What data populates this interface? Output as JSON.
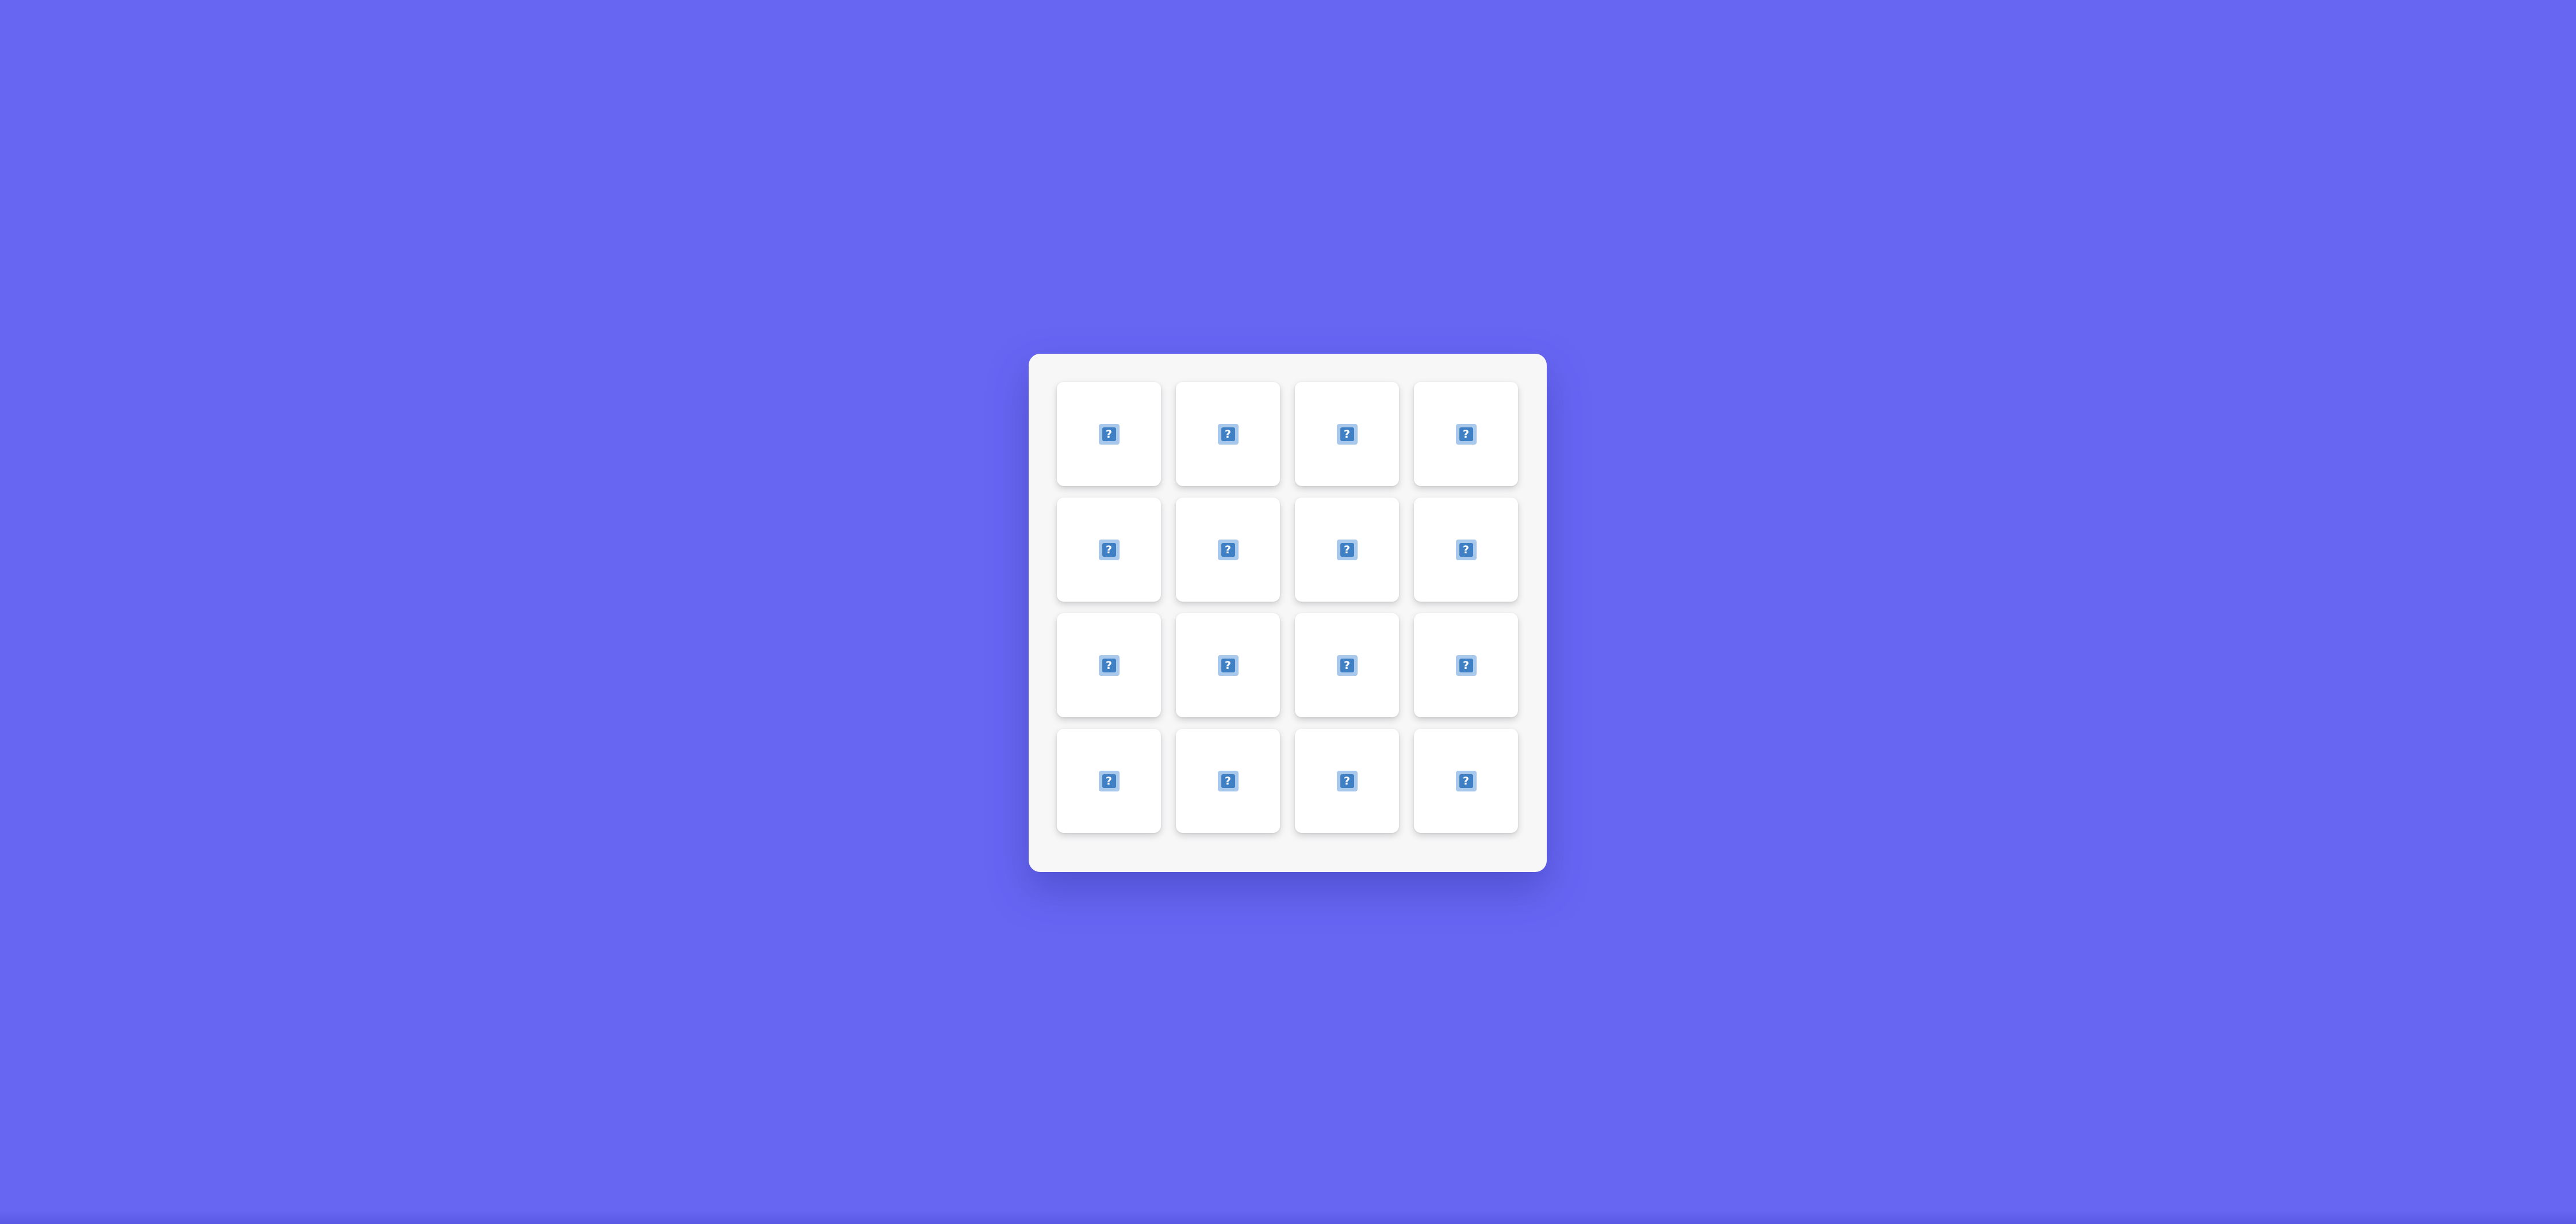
{
  "colors": {
    "background": "#6666f3",
    "board": "#f7f7f8",
    "card": "#ffffff",
    "icon_bg": "#a9c9ec",
    "icon_fg": "#3f7fc4"
  },
  "board": {
    "rows": 4,
    "columns": 4,
    "cards": [
      {
        "symbol": "?",
        "icon": "question-mark-icon",
        "face_down": true
      },
      {
        "symbol": "?",
        "icon": "question-mark-icon",
        "face_down": true
      },
      {
        "symbol": "?",
        "icon": "question-mark-icon",
        "face_down": true
      },
      {
        "symbol": "?",
        "icon": "question-mark-icon",
        "face_down": true
      },
      {
        "symbol": "?",
        "icon": "question-mark-icon",
        "face_down": true
      },
      {
        "symbol": "?",
        "icon": "question-mark-icon",
        "face_down": true
      },
      {
        "symbol": "?",
        "icon": "question-mark-icon",
        "face_down": true
      },
      {
        "symbol": "?",
        "icon": "question-mark-icon",
        "face_down": true
      },
      {
        "symbol": "?",
        "icon": "question-mark-icon",
        "face_down": true
      },
      {
        "symbol": "?",
        "icon": "question-mark-icon",
        "face_down": true
      },
      {
        "symbol": "?",
        "icon": "question-mark-icon",
        "face_down": true
      },
      {
        "symbol": "?",
        "icon": "question-mark-icon",
        "face_down": true
      },
      {
        "symbol": "?",
        "icon": "question-mark-icon",
        "face_down": true
      },
      {
        "symbol": "?",
        "icon": "question-mark-icon",
        "face_down": true
      },
      {
        "symbol": "?",
        "icon": "question-mark-icon",
        "face_down": true
      },
      {
        "symbol": "?",
        "icon": "question-mark-icon",
        "face_down": true
      }
    ]
  }
}
